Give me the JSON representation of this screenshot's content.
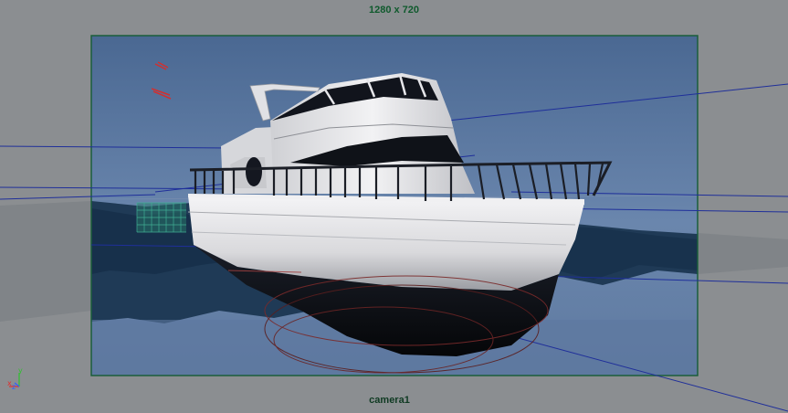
{
  "viewport": {
    "resolution_label": "1280 x 720",
    "camera_label": "camera1",
    "axis_gizmo": {
      "y_label": "y",
      "x_label": "x",
      "z_label": "z"
    }
  },
  "colors": {
    "background": "#8b8e91",
    "resolution_gate_border": "#1b5e3b",
    "label_text": "#0f5a2d",
    "sky_top": "#4a6a92",
    "sky_bottom": "#6f8ab0",
    "hull_white": "#e8e8ea",
    "hull_dark": "#0a0c12",
    "axis_x": "#e03030",
    "axis_y": "#30c030",
    "axis_z": "#3060ff"
  }
}
